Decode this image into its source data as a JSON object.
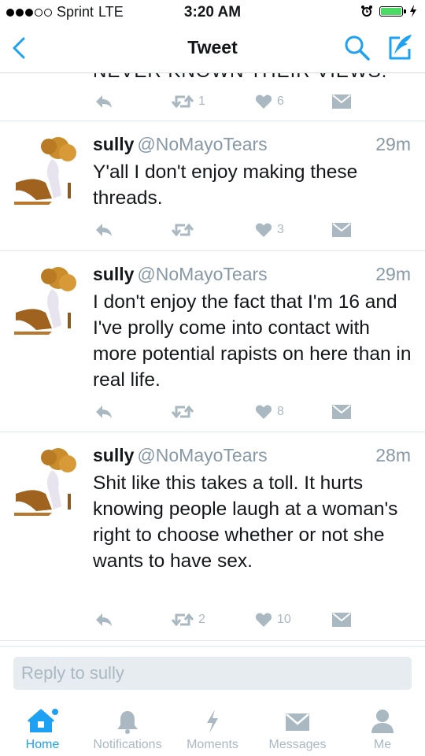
{
  "status_bar": {
    "carrier": "Sprint",
    "network": "LTE",
    "time": "3:20 AM",
    "signal_bars_filled": 3,
    "signal_bars_total": 5,
    "battery_color": "#4cd964"
  },
  "nav": {
    "title": "Tweet",
    "back_icon": "chevron-left-icon",
    "search_icon": "search-icon",
    "compose_icon": "compose-icon",
    "accent": "#1da1f2"
  },
  "partial_tweet": {
    "text": "NEVER KNOWN THEIR VIEWS.",
    "retweets": "1",
    "likes": "6"
  },
  "tweets": [
    {
      "name": "sully",
      "handle": "@NoMayoTears",
      "time": "29m",
      "text": "Y'all I don't enjoy making these threads.",
      "retweets": "",
      "likes": "3"
    },
    {
      "name": "sully",
      "handle": "@NoMayoTears",
      "time": "29m",
      "text": "I don't enjoy the fact that I'm 16 and I've prolly come into contact with more potential rapists on here than in real life.",
      "retweets": "",
      "likes": "8"
    },
    {
      "name": "sully",
      "handle": "@NoMayoTears",
      "time": "28m",
      "text": "Shit like this takes a toll. It hurts knowing people laugh at a woman's right to choose whether or not she wants to have sex.",
      "retweets": "2",
      "likes": "10"
    }
  ],
  "reply": {
    "placeholder": "Reply to sully",
    "value": ""
  },
  "tabs": [
    {
      "label": "Home",
      "icon": "home-icon",
      "active": true
    },
    {
      "label": "Notifications",
      "icon": "bell-icon",
      "active": false
    },
    {
      "label": "Moments",
      "icon": "lightning-icon",
      "active": false
    },
    {
      "label": "Messages",
      "icon": "envelope-icon",
      "active": false
    },
    {
      "label": "Me",
      "icon": "person-icon",
      "active": false
    }
  ],
  "colors": {
    "accent": "#1da1f2",
    "muted": "#aab8c2",
    "secondary_text": "#8899a6"
  }
}
